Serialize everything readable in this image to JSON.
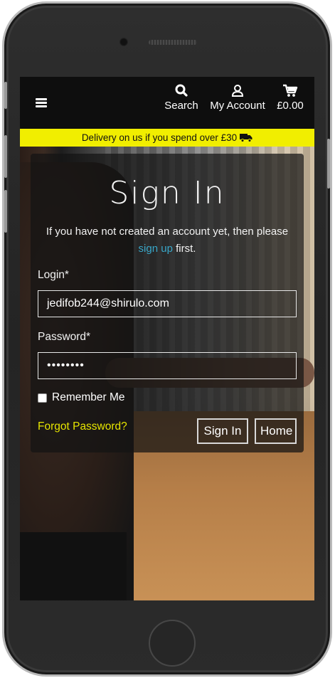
{
  "header": {
    "nav": {
      "search_label": "Search",
      "account_label": "My Account",
      "bag_total": "£0.00"
    }
  },
  "banner": {
    "text": "Delivery on us if you spend over £30",
    "icon": "truck-icon"
  },
  "signin": {
    "title": "Sign In",
    "intro_before": "If you have not created an account yet, then please",
    "intro_link": "sign up",
    "intro_after": "first.",
    "login_label": "Login*",
    "login_value": "jedifob244@shirulo.com",
    "password_label": "Password*",
    "password_value": "••••••••",
    "remember_label": "Remember Me",
    "forgot_label": "Forgot Password?",
    "signin_button": "Sign In",
    "home_button": "Home"
  },
  "colors": {
    "banner_bg": "#f1ee00",
    "link": "#39a7c9",
    "forgot": "#e6e500",
    "header_bg": "#0e0e0e"
  }
}
